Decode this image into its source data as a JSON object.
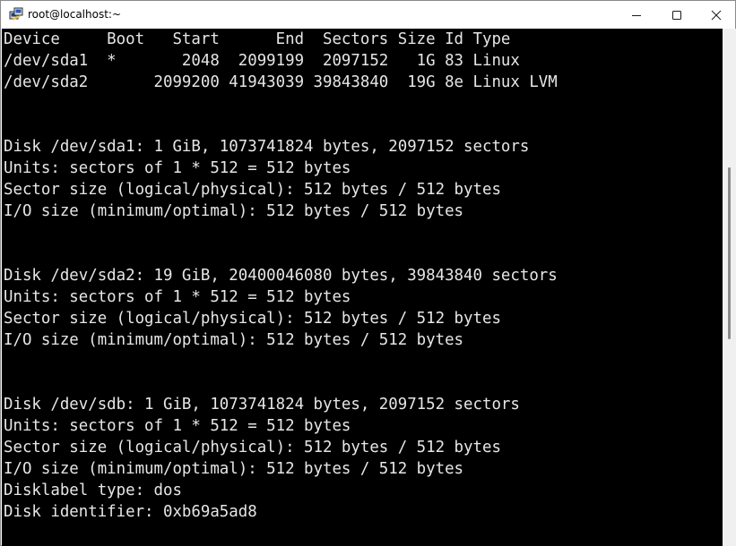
{
  "window": {
    "title": "root@localhost:~",
    "icon": "putty-icon",
    "controls": {
      "minimize": "minimize-icon",
      "maximize": "maximize-icon",
      "close": "close-icon"
    }
  },
  "terminal": {
    "background": "#000000",
    "foreground": "#e6e6e6",
    "lines": [
      "Device     Boot   Start      End  Sectors Size Id Type",
      "/dev/sda1  *       2048  2099199  2097152   1G 83 Linux",
      "/dev/sda2       2099200 41943039 39843840  19G 8e Linux LVM",
      "",
      "",
      "Disk /dev/sda1: 1 GiB, 1073741824 bytes, 2097152 sectors",
      "Units: sectors of 1 * 512 = 512 bytes",
      "Sector size (logical/physical): 512 bytes / 512 bytes",
      "I/O size (minimum/optimal): 512 bytes / 512 bytes",
      "",
      "",
      "Disk /dev/sda2: 19 GiB, 20400046080 bytes, 39843840 sectors",
      "Units: sectors of 1 * 512 = 512 bytes",
      "Sector size (logical/physical): 512 bytes / 512 bytes",
      "I/O size (minimum/optimal): 512 bytes / 512 bytes",
      "",
      "",
      "Disk /dev/sdb: 1 GiB, 1073741824 bytes, 2097152 sectors",
      "Units: sectors of 1 * 512 = 512 bytes",
      "Sector size (logical/physical): 512 bytes / 512 bytes",
      "I/O size (minimum/optimal): 512 bytes / 512 bytes",
      "Disklabel type: dos",
      "Disk identifier: 0xb69a5ad8"
    ]
  }
}
